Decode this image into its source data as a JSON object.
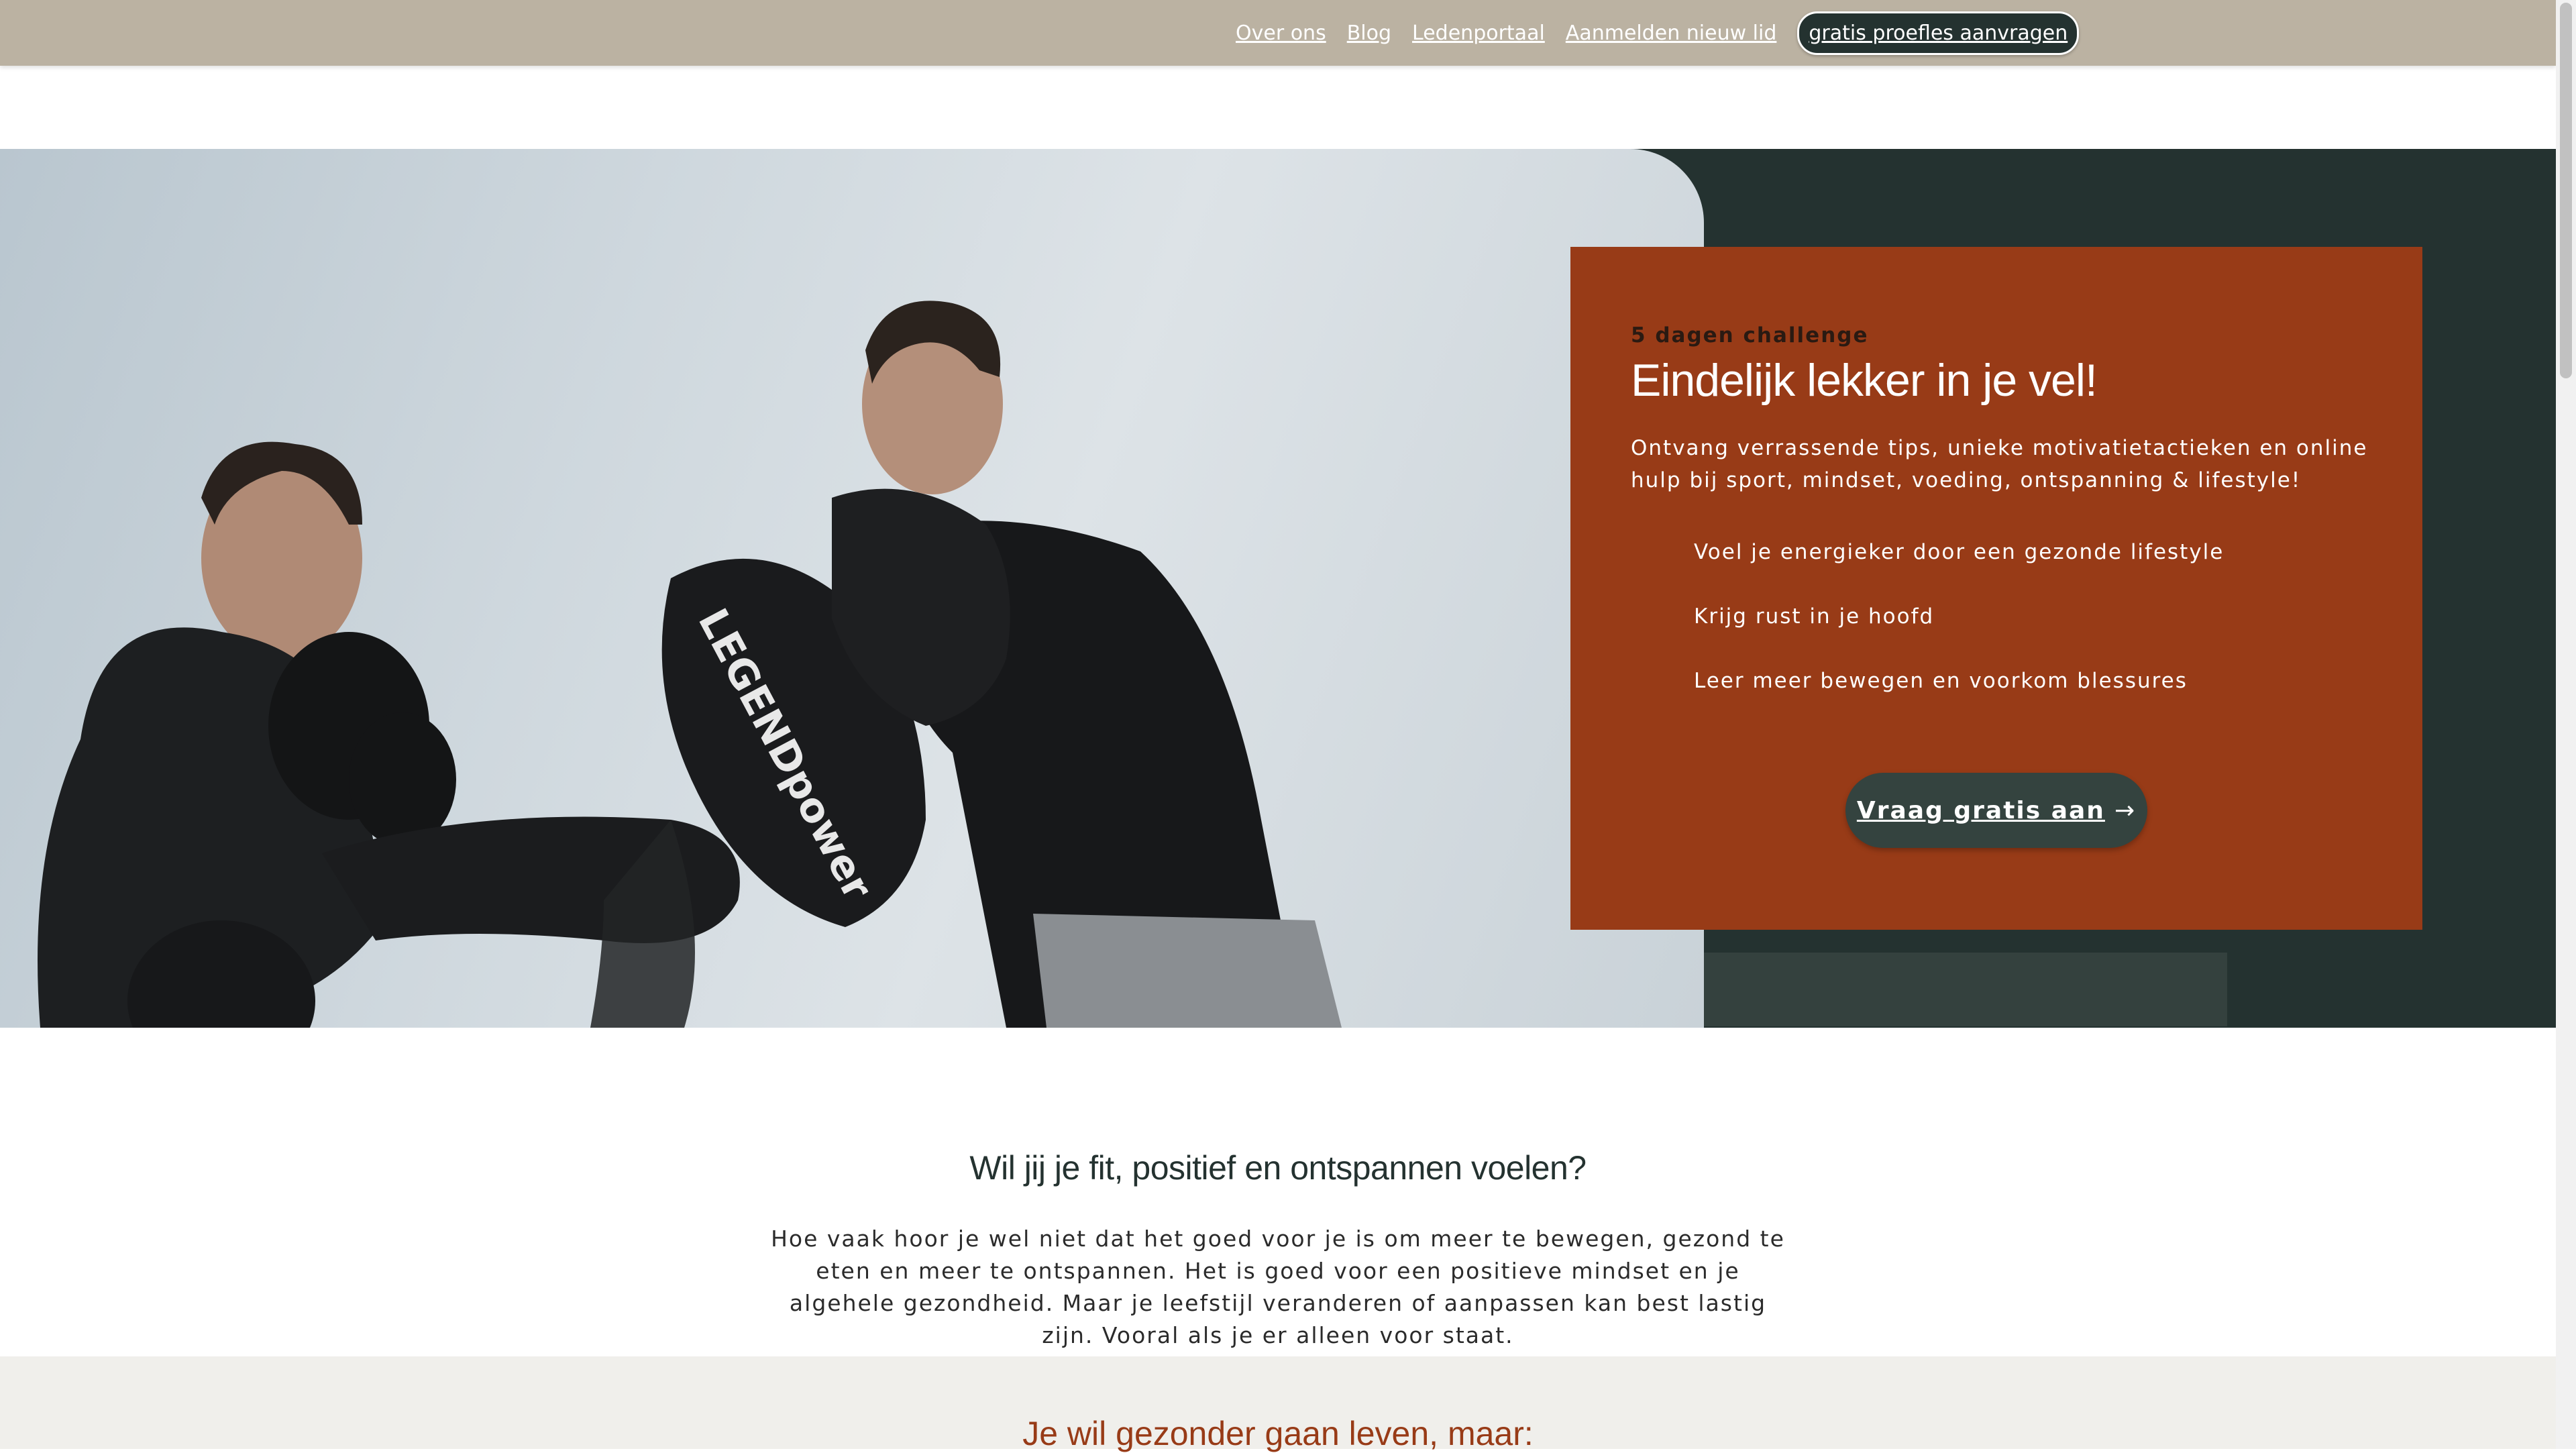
{
  "nav": {
    "items": [
      "Over ons",
      "Blog",
      "Ledenportaal",
      "Aanmelden nieuw lid"
    ],
    "cta": "gratis proefles aanvragen"
  },
  "hero": {
    "eyebrow": "5 dagen challenge",
    "title": "Eindelijk lekker in je vel!",
    "text": "Ontvang verrassende tips, unieke motivatietactieken en online hulp bij sport, mindset, voeding, ontspanning & lifestyle!",
    "benefits": [
      "Voel je energieker door een gezonde lifestyle",
      "Krijg rust in je hoofd",
      "Leer meer bewegen en voorkom blessures"
    ],
    "button_label": "Vraag gratis aan",
    "button_arrow": "→",
    "photo_text": "LEGENDpower"
  },
  "intro": {
    "title": "Wil jij je fit, positief en ontspannen voelen?",
    "text": "Hoe vaak hoor je wel niet dat het goed voor je is om meer te bewegen, gezond te eten en meer te ontspannen. Het is goed voor een positieve mindset en je algehele gezondheid. Maar je leefstijl veranderen of aanpassen kan best lastig zijn. Vooral als je er alleen voor staat."
  },
  "next_section": {
    "title": "Je wil gezonder gaan leven, maar:"
  },
  "colors": {
    "topbar": "#bbb2a2",
    "dark": "#243230",
    "rust": "#983b17",
    "band": "#f0efeb"
  }
}
